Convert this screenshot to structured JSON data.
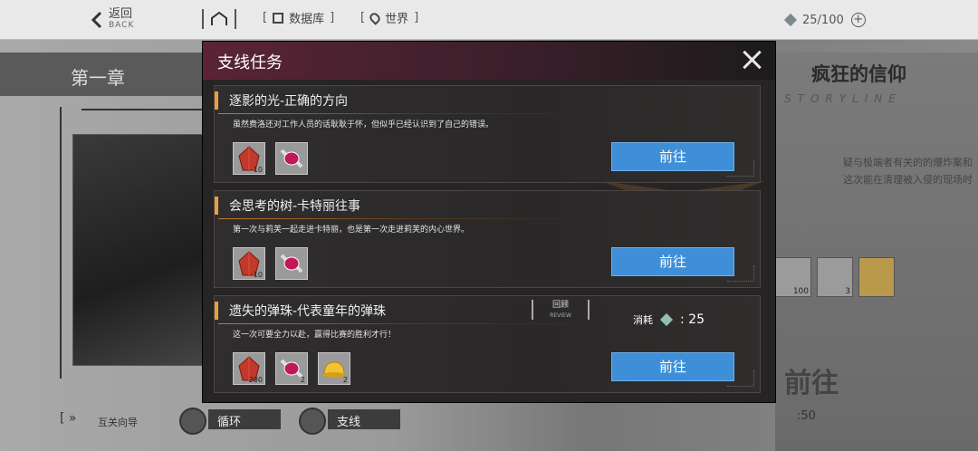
{
  "topbar": {
    "back_label": "返回",
    "back_sub": "BACK",
    "database_label": "数据库",
    "world_label": "世界",
    "counter": "25/100"
  },
  "background": {
    "chapter_label": "第一章",
    "right_title": "疯狂的信仰",
    "right_subtitle": "STORYLINE",
    "right_desc_1": "疑与极端者有关的的爆炸案和",
    "right_desc_2": "这次能在清理被入侵的现场时",
    "right_items": [
      {
        "qty": "100"
      },
      {
        "qty": "3"
      },
      {
        "qty": ""
      }
    ],
    "right_go": "前往",
    "right_cost": ":50",
    "bottom_guide": "互关向导",
    "bottom_tab1": "循环",
    "bottom_tab2": "支线"
  },
  "modal": {
    "title": "支线任务",
    "go_label": "前往",
    "cost_label": "消耗",
    "cost_value": "25",
    "review_label": "回顾",
    "review_sub": "REVIEW",
    "quests": [
      {
        "title": "逐影的光-正确的方向",
        "desc": "虽然费洛还对工作人员的话耿耿于怀，但似乎已经认识到了自己的错误。",
        "rewards": [
          {
            "icon": "red-crystal",
            "qty": "10"
          },
          {
            "icon": "candy",
            "qty": ""
          }
        ]
      },
      {
        "title": "会思考的树-卡特丽往事",
        "desc": "第一次与莉芙一起走进卡特丽，也是第一次走进莉芙的内心世界。",
        "rewards": [
          {
            "icon": "red-crystal",
            "qty": "10"
          },
          {
            "icon": "candy",
            "qty": ""
          }
        ]
      },
      {
        "title": "遗失的弹珠-代表童年的弹珠",
        "desc": "这一次可要全力以赴，赢得比赛的胜利才行！",
        "rewards": [
          {
            "icon": "red-crystal",
            "qty": "200"
          },
          {
            "icon": "candy",
            "qty": "2"
          },
          {
            "icon": "gold-pudding",
            "qty": "2"
          }
        ]
      }
    ]
  },
  "colors": {
    "go_button": "#3e8fd7",
    "accent": "#e6a13c",
    "header": "#5a2436"
  }
}
